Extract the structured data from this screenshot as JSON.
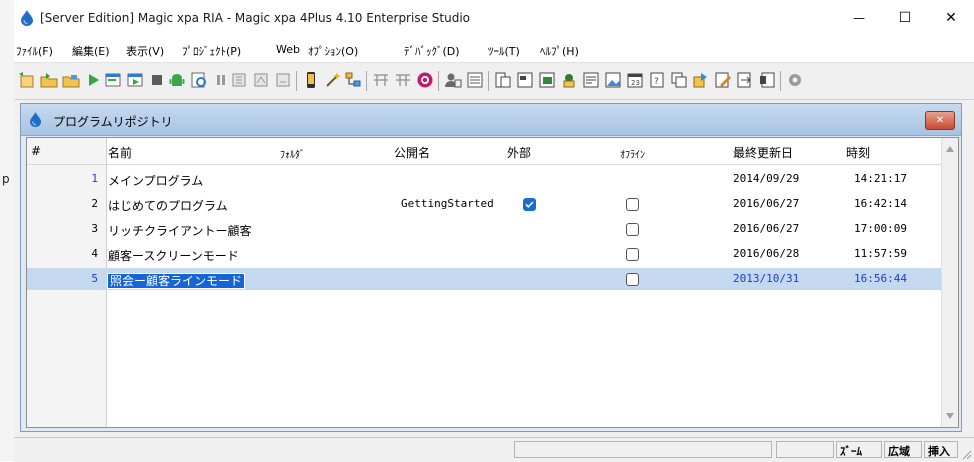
{
  "window": {
    "title": "[Server Edition] Magic xpa RIA - Magic xpa 4Plus 4.10 Enterprise Studio",
    "minimize": "—",
    "maximize": "☐",
    "close": "✕"
  },
  "menu": [
    "ﾌｧｲﾙ(F)",
    "編集(E)",
    "表示(V)",
    "ﾌﾟﾛｼﾞｪｸﾄ(P)",
    "Web",
    "ｵﾌﾟｼｮﾝ(O)",
    "ﾃﾞﾊﾞｯｸﾞ(D)",
    "ﾂｰﾙ(T)",
    "ﾍﾙﾌﾟ(H)"
  ],
  "left_strip_char": "p",
  "repository": {
    "title": "プログラムリポジトリ",
    "close": "✕",
    "columns": {
      "index": "#",
      "name": "名前",
      "folder": "ﾌｫﾙﾀﾞ",
      "public_name": "公開名",
      "external": "外部",
      "offline": "ｵﾌﾗｲﾝ",
      "last_updated": "最終更新日",
      "time": "時刻"
    },
    "rows": [
      {
        "index": "1",
        "name": "メインプログラム",
        "public_name": "",
        "external": false,
        "offline": false,
        "date": "2014/09/29",
        "time": "14:21:17"
      },
      {
        "index": "2",
        "name": "はじめてのプログラム",
        "public_name": "GettingStarted",
        "external": true,
        "offline": false,
        "date": "2016/06/27",
        "time": "16:42:14"
      },
      {
        "index": "3",
        "name": "リッチクライアントー顧客",
        "public_name": "",
        "external": false,
        "offline": false,
        "date": "2016/06/27",
        "time": "17:00:09"
      },
      {
        "index": "4",
        "name": "顧客ースクリーンモード",
        "public_name": "",
        "external": false,
        "offline": false,
        "date": "2016/06/28",
        "time": "11:57:59"
      },
      {
        "index": "5",
        "name": "照会ー顧客ラインモード",
        "public_name": "",
        "external": false,
        "offline": false,
        "date": "2013/10/31",
        "time": "16:56:44"
      }
    ]
  },
  "statusbar": {
    "zoom": "ｽﾞｰﾑ",
    "scope": "広域",
    "insert": "挿入"
  },
  "colors": {
    "selection": "#c4d9f0",
    "edit_highlight": "#1565d8",
    "checkbox_checked": "#1b6bd1"
  }
}
